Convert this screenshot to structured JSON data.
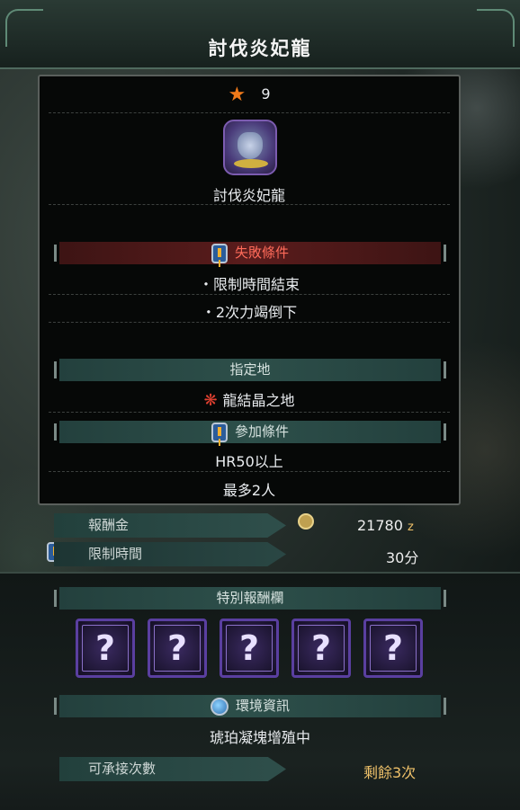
{
  "quest": {
    "title": "討伐炎妃龍",
    "rank": "9",
    "target_name": "討伐炎妃龍"
  },
  "fail_conditions": {
    "label": "失敗條件",
    "items": [
      "・限制時間結束",
      "・2次力竭倒下"
    ]
  },
  "location": {
    "label": "指定地",
    "name": "龍結晶之地"
  },
  "join_conditions": {
    "label": "參加條件",
    "hr": "HR50以上",
    "players": "最多2人"
  },
  "reward": {
    "label": "報酬金",
    "amount": "21780",
    "unit": "z"
  },
  "time_limit": {
    "label": "限制時間",
    "value": "30分"
  },
  "special_rewards": {
    "label": "特別報酬欄",
    "slots": [
      "?",
      "?",
      "?",
      "?",
      "?"
    ]
  },
  "environment": {
    "label": "環境資訊",
    "value": "琥珀凝塊增殖中"
  },
  "accept_count": {
    "label": "可承接次數",
    "value": "剩餘3次"
  },
  "colors": {
    "fail_banner": "#5a1c1c",
    "teal_banner": "#2d4f4a",
    "gold": "#f0c26a",
    "star": "#f07a1a"
  },
  "icons": [
    "star-icon",
    "monster-icon",
    "quest-badge-icon",
    "flame-icon",
    "zenny-icon",
    "globe-icon",
    "question-slot-icon"
  ]
}
